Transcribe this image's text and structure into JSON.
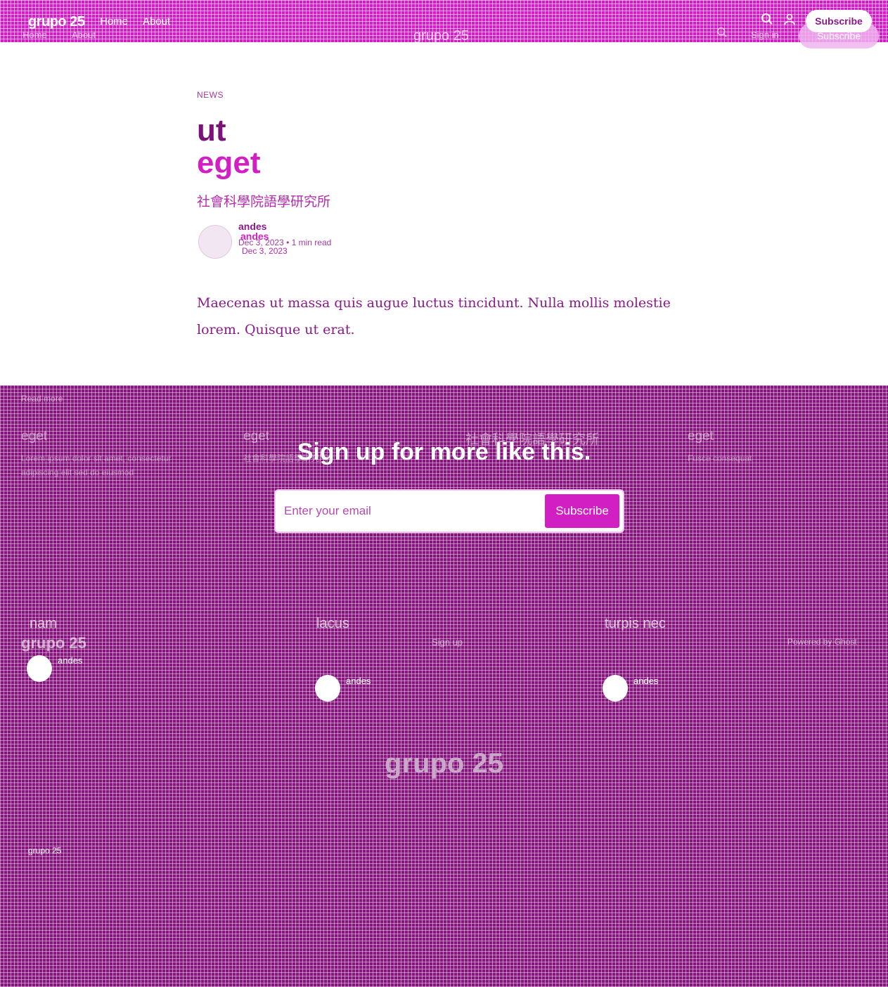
{
  "header": {
    "brand": "grupo 25",
    "brand_ghost": "grupo 25",
    "nav": [
      {
        "label": "Home"
      },
      {
        "label": "About"
      }
    ],
    "nav_ghost": [
      {
        "label": "Home"
      },
      {
        "label": "About"
      }
    ],
    "signin_ghost": "Sign in",
    "subscribe_label": "Subscribe",
    "subscribe_ghost_label": "Subscribe"
  },
  "article": {
    "tag": "NEWS",
    "title_line1": "ut",
    "title_line2": "eget",
    "excerpt": "社會科學院語學研究所",
    "author": "andes",
    "author_ghost": "andes",
    "date": "Dec 3, 2023",
    "read_time": "1 min read",
    "date_ghost": "Dec 3, 2023",
    "body": "Maecenas ut massa quis augue luctus tincidunt. Nulla mollis molestie lorem. Quisque ut erat."
  },
  "footer": {
    "read_more": "Read more",
    "ghost_cards": [
      {
        "title": "eget",
        "text": "Lorem ipsum dolor sit amet, consectetur adipiscing elit sed do eiusmod"
      },
      {
        "title": "eget",
        "text": "社會科學院語學研究所"
      },
      {
        "title": "社會科學院語學研究所",
        "text": ""
      },
      {
        "title": "eget",
        "text": "Fusce consequat"
      }
    ],
    "signup": {
      "title": "Sign up for more like this.",
      "placeholder": "Enter your email",
      "button": "Subscribe"
    },
    "cards": [
      {
        "title": "nam",
        "author": "andes"
      },
      {
        "title": "lacus",
        "author": "andes"
      },
      {
        "title": "turpis nec",
        "author": "andes"
      }
    ],
    "card_brand_ghost": "grupo 25",
    "signup_ghost": "Sign up",
    "powered": "Powered by Ghost",
    "big_brand": "grupo 25",
    "bottom_brand": "grupo 25"
  }
}
